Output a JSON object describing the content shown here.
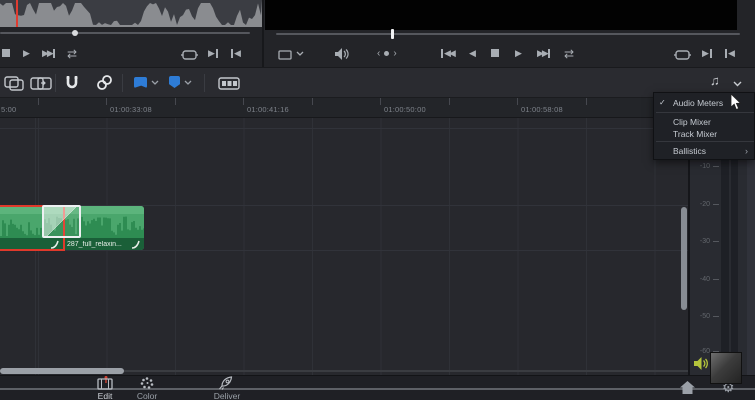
{
  "icons": {
    "play": "▶",
    "reverse": "◀",
    "prev_clip": "◀◀",
    "next_clip": "▶▶",
    "loop": "⇄",
    "jog_left": "‹",
    "jog_right": "›",
    "music_note": "♫",
    "home": "⌂",
    "gear": "⚙",
    "minus": "−",
    "plus": "+",
    "check": "✓",
    "submenu_arrow": "›"
  },
  "meter_menu": {
    "items": [
      {
        "label": "Audio Meters",
        "check": "✓"
      },
      {
        "label": "Clip Mixer"
      },
      {
        "label": "Track Mixer"
      },
      {
        "label": "Ballistics",
        "arrow": "›"
      }
    ]
  },
  "ruler": {
    "labels": [
      "5:00",
      "01:00:33:08",
      "01:00:41:16",
      "01:00:50:00",
      "01:00:58:08"
    ]
  },
  "timeline": {
    "clip_name": "287_full_relaxin..."
  },
  "audio_meter": {
    "scale": [
      "-10",
      "-20",
      "-30",
      "-40",
      "-50",
      "-60"
    ]
  },
  "bottom_nav": {
    "pages": [
      "Edit",
      "Color",
      "Deliver"
    ]
  },
  "colors": {
    "accent_blue": "#2e7cd6",
    "clip_green": "#4da56d",
    "selection_red": "#e0392b",
    "speaker_green": "#b4c43c"
  }
}
